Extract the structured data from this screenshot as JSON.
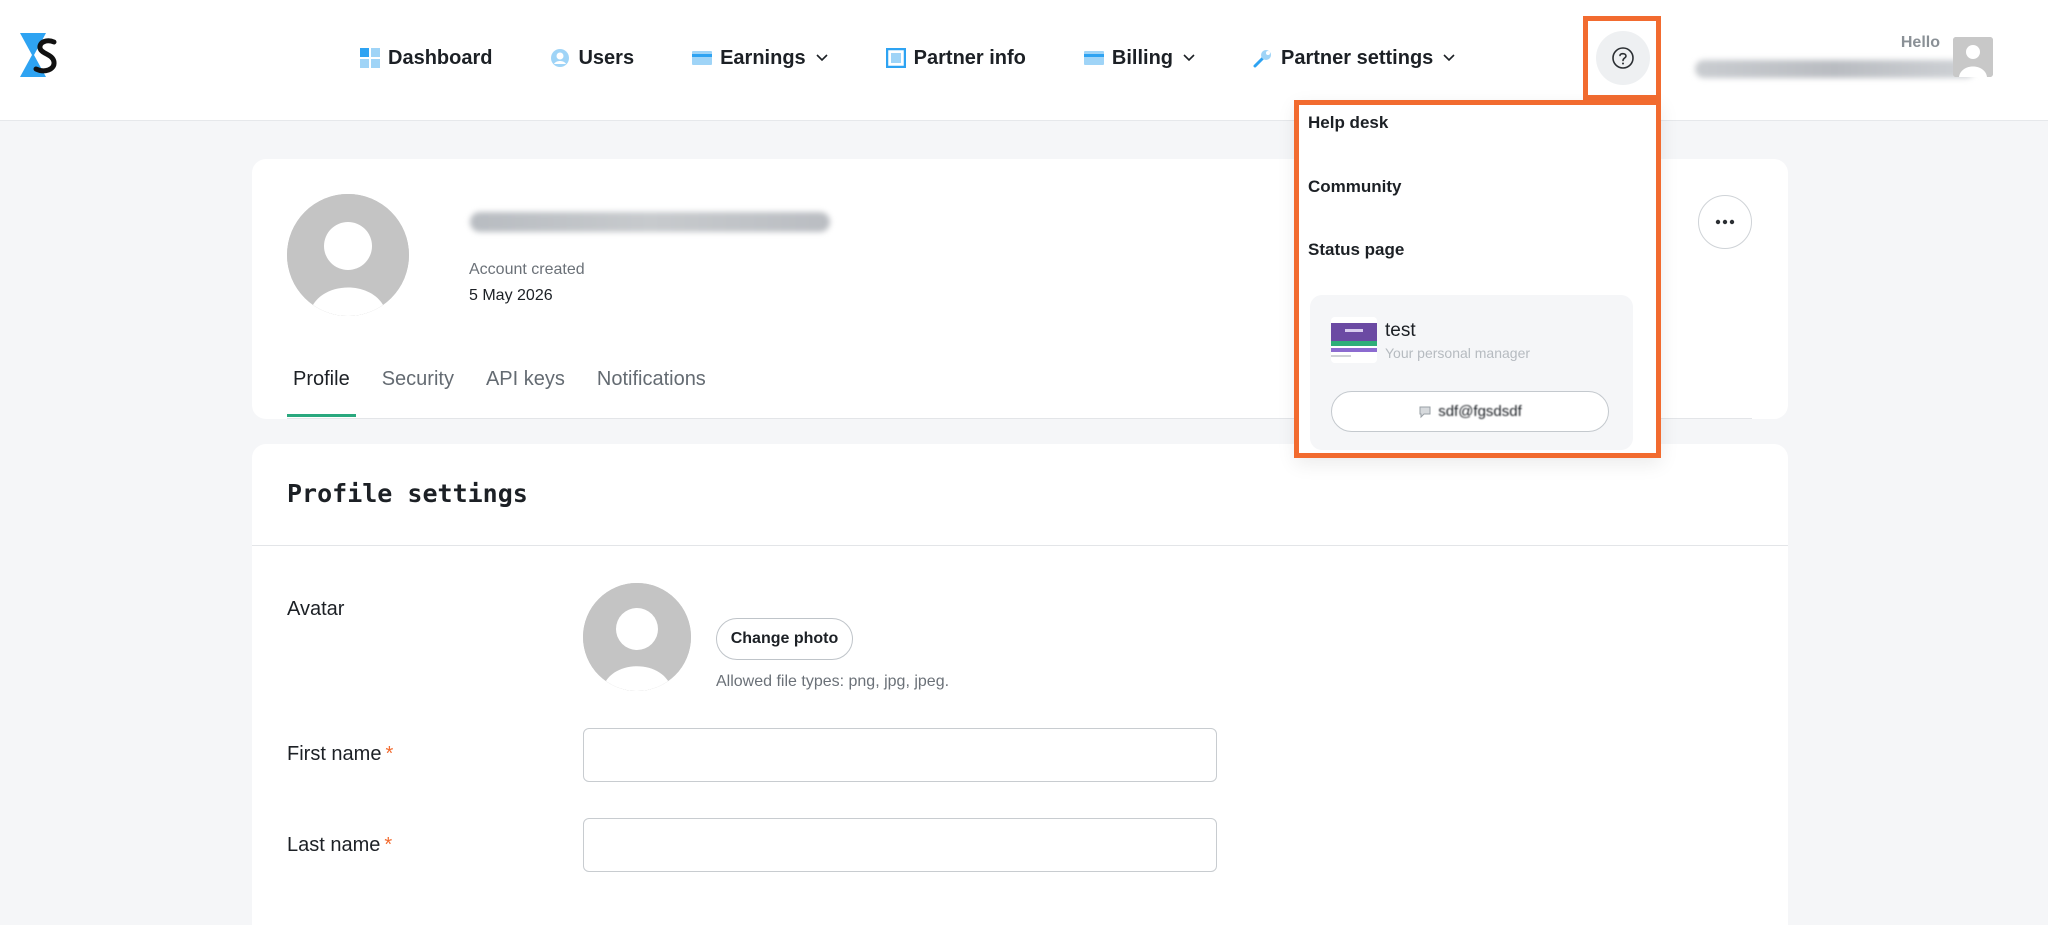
{
  "nav": {
    "items": [
      {
        "label": "Dashboard",
        "icon": "dashboard-icon",
        "dropdown": false
      },
      {
        "label": "Users",
        "icon": "users-icon",
        "dropdown": false
      },
      {
        "label": "Earnings",
        "icon": "card-icon",
        "dropdown": true
      },
      {
        "label": "Partner info",
        "icon": "square-icon",
        "dropdown": false
      },
      {
        "label": "Billing",
        "icon": "card-icon",
        "dropdown": true
      },
      {
        "label": "Partner settings",
        "icon": "wrench-icon",
        "dropdown": true
      }
    ]
  },
  "header": {
    "hello": "Hello"
  },
  "profile": {
    "account_created_label": "Account created",
    "account_created_date": "5 May 2026"
  },
  "tabs": [
    "Profile",
    "Security",
    "API keys",
    "Notifications"
  ],
  "settings": {
    "title": "Profile settings",
    "avatar_label": "Avatar",
    "change_photo": "Change photo",
    "allowed_types": "Allowed file types: png, jpg, jpeg.",
    "first_name_label": "First name",
    "last_name_label": "Last name",
    "required_mark": "*",
    "first_name_value": "",
    "last_name_value": ""
  },
  "help_menu": {
    "items": [
      "Help desk",
      "Community",
      "Status page"
    ],
    "manager_name": "test",
    "manager_role": "Your personal manager",
    "manager_contact": "sdf@fgsdsdf"
  },
  "colors": {
    "accent_tab": "#2aa87e",
    "highlight": "#f26b2f",
    "required": "#f26b2f",
    "logo_blue": "#2ea3f2"
  }
}
